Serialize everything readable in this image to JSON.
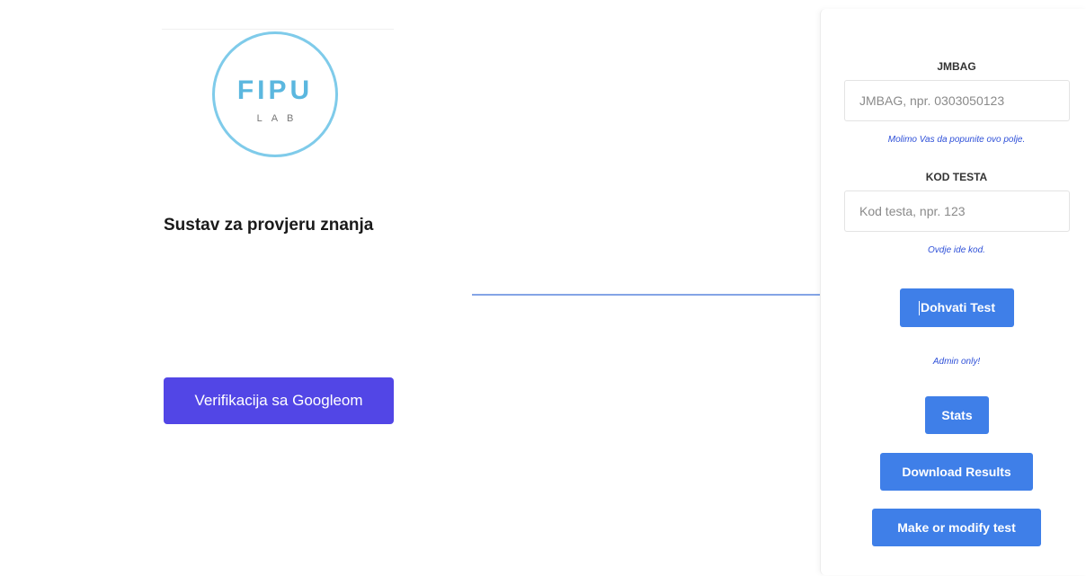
{
  "logo": {
    "main": "FIPU",
    "sub": "LAB"
  },
  "left": {
    "title": "Sustav za provjeru znanja",
    "google_button": "Verifikacija sa Googleom"
  },
  "form": {
    "jmbag_label": "JMBAG",
    "jmbag_placeholder": "JMBAG, npr. 0303050123",
    "jmbag_value": "",
    "jmbag_hint": "Molimo Vas da popunite ovo polje.",
    "code_label": "KOD TESTA",
    "code_placeholder": "Kod testa, npr. 123",
    "code_value": "",
    "code_hint": "Ovdje ide kod.",
    "fetch_button": "Dohvati Test"
  },
  "admin": {
    "note": "Admin only!",
    "stats_button": "Stats",
    "download_button": "Download Results",
    "make_test_button": "Make or modify test"
  },
  "colors": {
    "google_button": "#5246e6",
    "primary_button": "#3f7fe8",
    "hint_text": "#2d4fd8",
    "logo": "#5bb7df",
    "arrow": "#3a6fd8"
  }
}
